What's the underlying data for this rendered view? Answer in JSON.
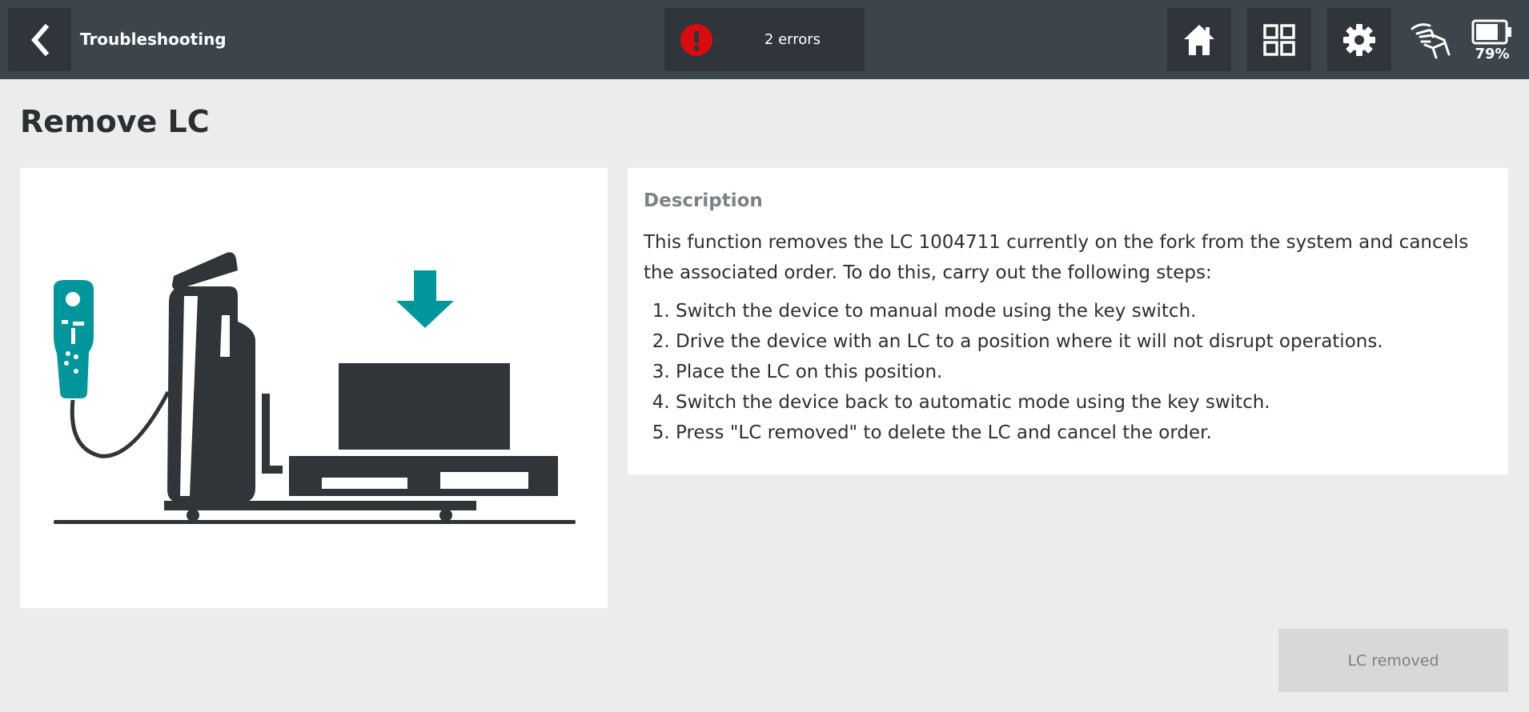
{
  "header": {
    "back_icon": "chevron-left-icon",
    "title": "Troubleshooting",
    "errors": {
      "icon": "error-exclamation-icon",
      "label": "2 errors",
      "color": "#d60c10"
    },
    "home_icon": "home-icon",
    "apps_icon": "grid-icon",
    "settings_icon": "gear-icon",
    "touch_icon": "hand-touch-icon",
    "battery": {
      "icon": "battery-icon",
      "level": 0.79,
      "label": "79%"
    }
  },
  "page": {
    "title": "Remove LC"
  },
  "illustration": {
    "subject": "remote-control-and-pallet-truck-with-lc",
    "accent_color": "#00969c"
  },
  "description": {
    "heading": "Description",
    "body": "This function removes the LC 1004711 currently on the fork from the system and cancels the associated order. To do this, carry out the following steps:",
    "steps": [
      "Switch the device to manual mode using the key switch.",
      "Drive the device with an LC to a position where it will not disrupt operations.",
      "Place the LC on this position.",
      "Switch the device back to automatic mode using the key switch.",
      "Press \"LC removed\" to delete the LC and cancel the order."
    ]
  },
  "actions": {
    "lc_removed_label": "LC removed"
  }
}
